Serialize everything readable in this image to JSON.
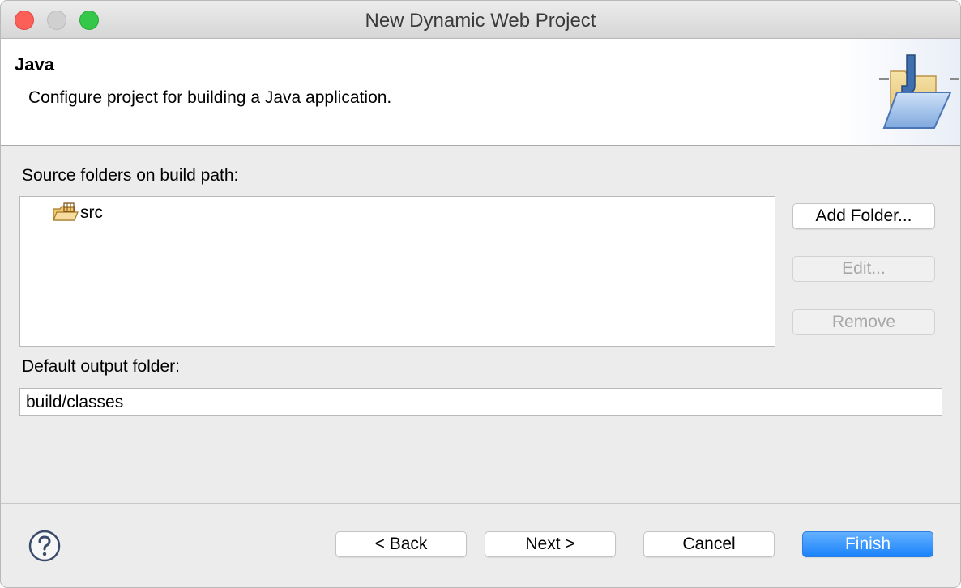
{
  "window": {
    "title": "New Dynamic Web Project"
  },
  "banner": {
    "title": "Java",
    "description": "Configure project for building a Java application.",
    "icon": "java-folder-wizard-icon"
  },
  "source": {
    "label": "Source folders on build path:",
    "items": [
      {
        "label": "src",
        "icon": "source-folder-icon"
      }
    ]
  },
  "side_buttons": {
    "add_folder": "Add Folder...",
    "edit": "Edit...",
    "remove": "Remove"
  },
  "output": {
    "label": "Default output folder:",
    "value": "build/classes"
  },
  "footer": {
    "help_icon": "help-icon",
    "back": "< Back",
    "next": "Next >",
    "cancel": "Cancel",
    "finish": "Finish"
  },
  "colors": {
    "accent": "#1a82fb",
    "close": "#fc5f57",
    "maximize": "#35c748"
  }
}
